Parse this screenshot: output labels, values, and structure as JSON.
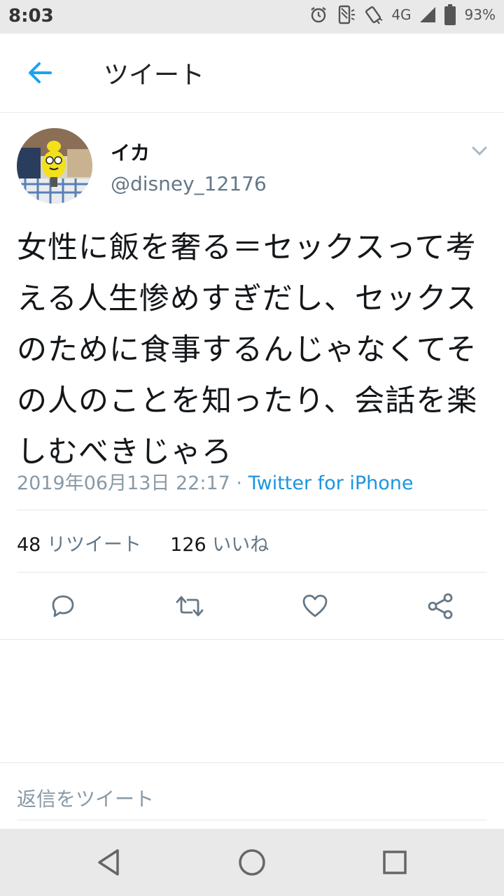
{
  "status_bar": {
    "time": "8:03",
    "network": "4G",
    "battery": "93%"
  },
  "header": {
    "title": "ツイート",
    "back_icon": "arrow-left-icon"
  },
  "tweet": {
    "display_name": "イカ",
    "handle": "@disney_12176",
    "text_lines": [
      "女性に飯を奢る＝セックスって考",
      "える人生惨めすぎだし、セックス",
      "のために食事するんじゃなくてそ",
      "の人のことを知ったり、会話を楽",
      "しむべきじゃろ"
    ],
    "timestamp": "2019年06月13日 22:17",
    "separator": "·",
    "source": "Twitter for iPhone",
    "retweet_count": "48",
    "retweet_label": "リツイート",
    "like_count": "126",
    "like_label": "いいね"
  },
  "actions": [
    "reply-icon",
    "retweet-icon",
    "like-icon",
    "share-icon"
  ],
  "reply_box": {
    "placeholder": "返信をツイート"
  },
  "colors": {
    "accent": "#1da1f2",
    "link": "#1b95e0",
    "muted": "#657786",
    "divider": "#e1e8ed"
  }
}
